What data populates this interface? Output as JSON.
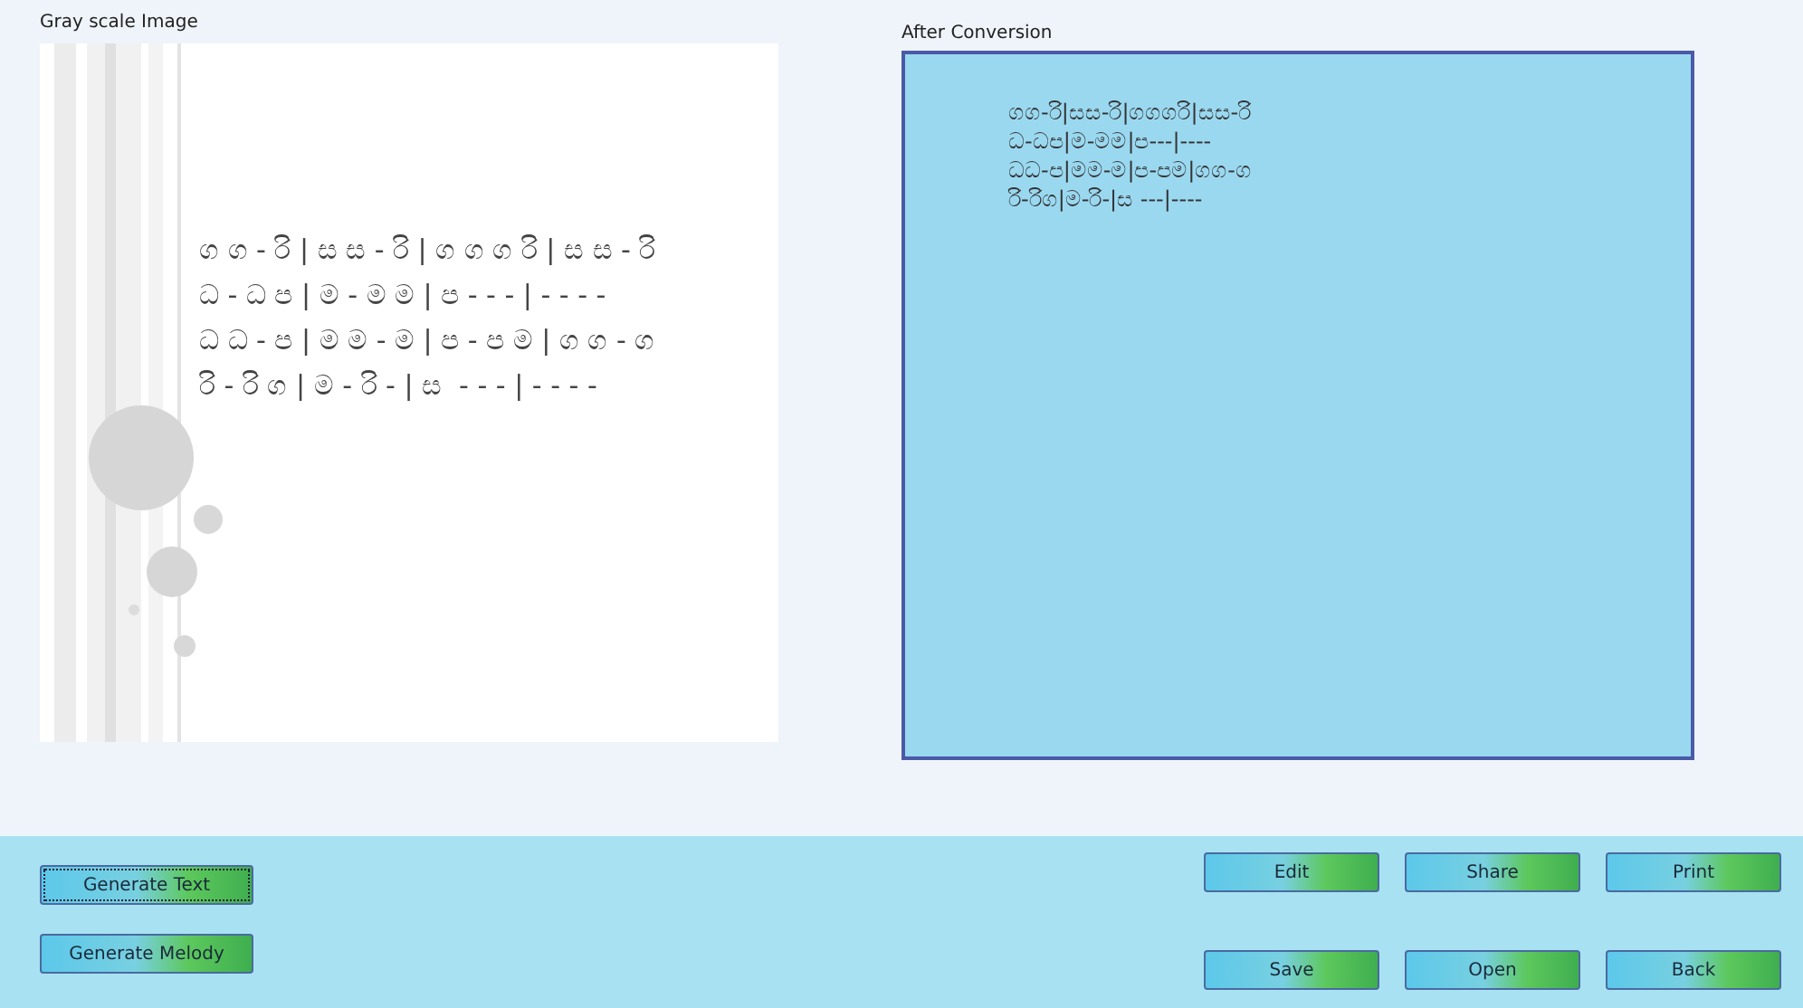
{
  "gray_image": {
    "title": "Gray scale Image",
    "lines": [
      "ග ග - රි | ස ස - රි | ග ග ග රි | ස ස - රි",
      "ධ - ධ ප | ම - ම ම | ප - - - | - - - -",
      "ධ ධ - ප | ම ම - ම | ප - ප ම | ග ග - ග",
      "රි - රි ග | ම - රි - | ස  - - - | - - - -"
    ]
  },
  "conversion": {
    "title": "After Conversion",
    "lines": [
      "ගග-රි|සස-රි|ගගගරි|සස-රි",
      "ධ-ධප|ම-මම|ප---|----",
      "ධධ-ප|මම-ම|ප-පම|ගග-ග",
      "රි-රිග|ම-රි-|ස ---|----"
    ]
  },
  "left_buttons": [
    {
      "label": "Generate Text",
      "focused": true
    },
    {
      "label": "Generate Melody",
      "focused": false
    }
  ],
  "right_buttons": [
    {
      "label": "Edit"
    },
    {
      "label": "Share"
    },
    {
      "label": "Print"
    },
    {
      "label": "Save"
    },
    {
      "label": "Open"
    },
    {
      "label": "Back"
    }
  ]
}
